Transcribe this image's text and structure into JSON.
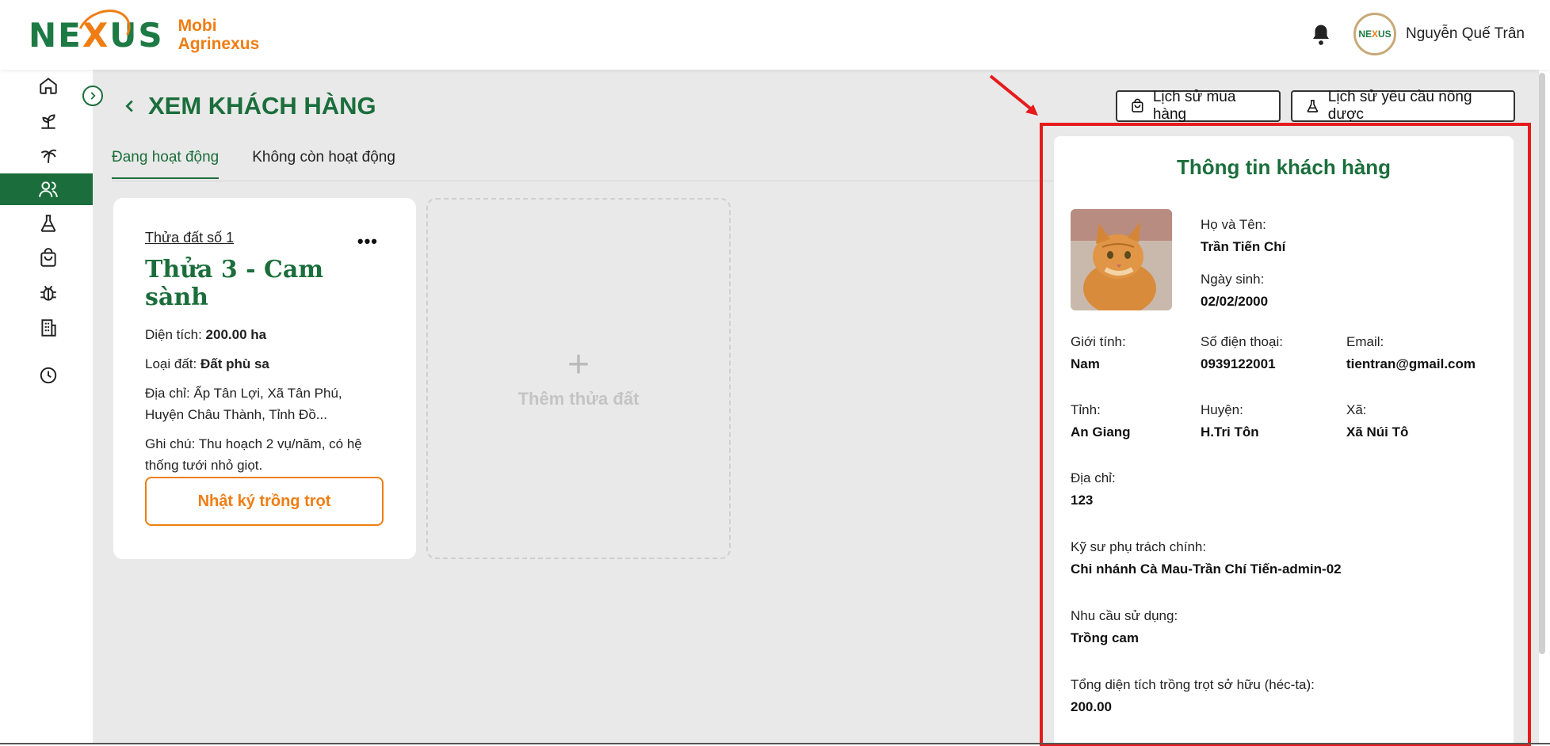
{
  "header": {
    "logo_mark": "NE",
    "logo_mark_x": "X",
    "logo_mark_end": "US",
    "logo_line1": "Mobi",
    "logo_line2": "Agrinexus",
    "avatar_text_a": "NE",
    "avatar_text_x": "X",
    "avatar_text_b": "US",
    "user_name": "Nguyễn Quế Trân"
  },
  "sidebar": {
    "items": [
      "home-icon",
      "plant-icon",
      "palm-tree-icon",
      "users-icon",
      "flask-icon",
      "shopping-bag-icon",
      "bug-icon",
      "building-icon",
      "clock-icon"
    ],
    "active_index": 3
  },
  "page": {
    "title": "XEM KHÁCH HÀNG",
    "tabs": [
      {
        "label": "Đang hoạt động",
        "active": true
      },
      {
        "label": "Không còn hoạt động",
        "active": false
      }
    ],
    "purchase_history": "Lịch sử mua hàng",
    "pesticide_history": "Lịch sử yêu cầu nông dược"
  },
  "plot": {
    "index": "Thửa đất số 1",
    "name": "Thửa 3 - Cam sành",
    "area_label": "Diện tích:",
    "area_value": "200.00 ha",
    "soil_label": "Loại đất:",
    "soil_value": "Đất phù sa",
    "address": "Địa chỉ: Ấp Tân Lợi, Xã Tân Phú, Huyện Châu Thành, Tỉnh Đồ...",
    "note": "Ghi chú: Thu hoạch 2 vụ/năm, có hệ thống tưới nhỏ giọt.",
    "diary_button": "Nhật ký trồng trọt",
    "more": "•••"
  },
  "add_plot": {
    "plus": "+",
    "label": "Thêm thửa đất"
  },
  "customer": {
    "title": "Thông tin khách hàng",
    "name_label": "Họ và Tên:",
    "name": "Trần Tiến Chí",
    "dob_label": "Ngày sinh:",
    "dob": "02/02/2000",
    "gender_label": "Giới tính:",
    "gender": "Nam",
    "phone_label": "Số điện thoại:",
    "phone": "0939122001",
    "email_label": "Email:",
    "email": "tientran@gmail.com",
    "province_label": "Tỉnh:",
    "province": "An Giang",
    "district_label": "Huyện:",
    "district": "H.Tri Tôn",
    "ward_label": "Xã:",
    "ward": "Xã Núi Tô",
    "address_label": "Địa chỉ:",
    "address": "123",
    "engineer_label": "Kỹ sư phụ trách chính:",
    "engineer": "Chi nhánh Cà Mau-Trần Chí Tiến-admin-02",
    "need_label": "Nhu cầu sử dụng:",
    "need": "Trồng cam",
    "total_area_label": "Tổng diện tích trồng trọt sở hữu (héc-ta):",
    "total_area": "200.00"
  },
  "colors": {
    "brand_green": "#1b6e3b",
    "brand_orange": "#f07d13",
    "highlight_red": "#e61b1b"
  }
}
